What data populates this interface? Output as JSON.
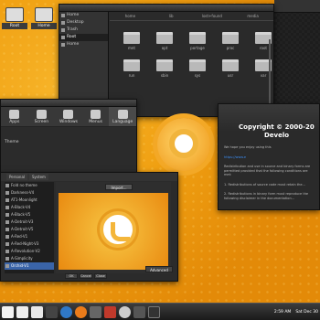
{
  "desktop": {
    "icons": [
      {
        "label": "Root"
      },
      {
        "label": "Home"
      }
    ]
  },
  "file_manager": {
    "sidebar": [
      {
        "label": "Home"
      },
      {
        "label": "Desktop"
      },
      {
        "label": "Trash"
      },
      {
        "label": "Root"
      },
      {
        "label": "Home"
      }
    ],
    "breadcrumbs": [
      "home",
      "lib",
      "lost+found",
      "media"
    ],
    "folders": [
      "mnt",
      "opt",
      "portage",
      "proc",
      "root",
      "run",
      "sbin",
      "sys",
      "usr",
      "var"
    ]
  },
  "settings": {
    "tools": [
      {
        "label": "Apps"
      },
      {
        "label": "Screen"
      },
      {
        "label": "Windows"
      },
      {
        "label": "Menus"
      },
      {
        "label": "Language"
      }
    ],
    "section": "Theme"
  },
  "theme_dialog": {
    "tabs": [
      "Personal",
      "System"
    ],
    "import_label": "Import...",
    "advanced_label": "Advanced",
    "buttons": [
      "OK",
      "Cancel",
      "Close"
    ],
    "themes": [
      "Fold no theme",
      "Darkness-V4",
      "AT1-Moonlight",
      "A-Black-V4",
      "A-Black-V5",
      "A-Detroit-V3",
      "A-Detroit-V5",
      "A-Red-V1",
      "A-Red-Night-V3",
      "A-Revolution-V2",
      "A-Simplicity",
      "A-Winter",
      "sAur12",
      "Orchid-V1"
    ],
    "selected": "Orchid-V1"
  },
  "about": {
    "line1": "Copyright © 2000-20",
    "line2": "Develo",
    "text1": "We hope you enjoy using this",
    "link": "https://www.e",
    "text2": "Redistribution and use in source and binary forms are permitted provided that the following conditions are met:",
    "list1": "1. Redistributions of source code must retain the...",
    "list2": "2. Redistributions in binary form must reproduce the following disclaimer in the documentation..."
  },
  "taskbar": {
    "clock": "2:59 AM",
    "date": "Sat Dec 30"
  }
}
